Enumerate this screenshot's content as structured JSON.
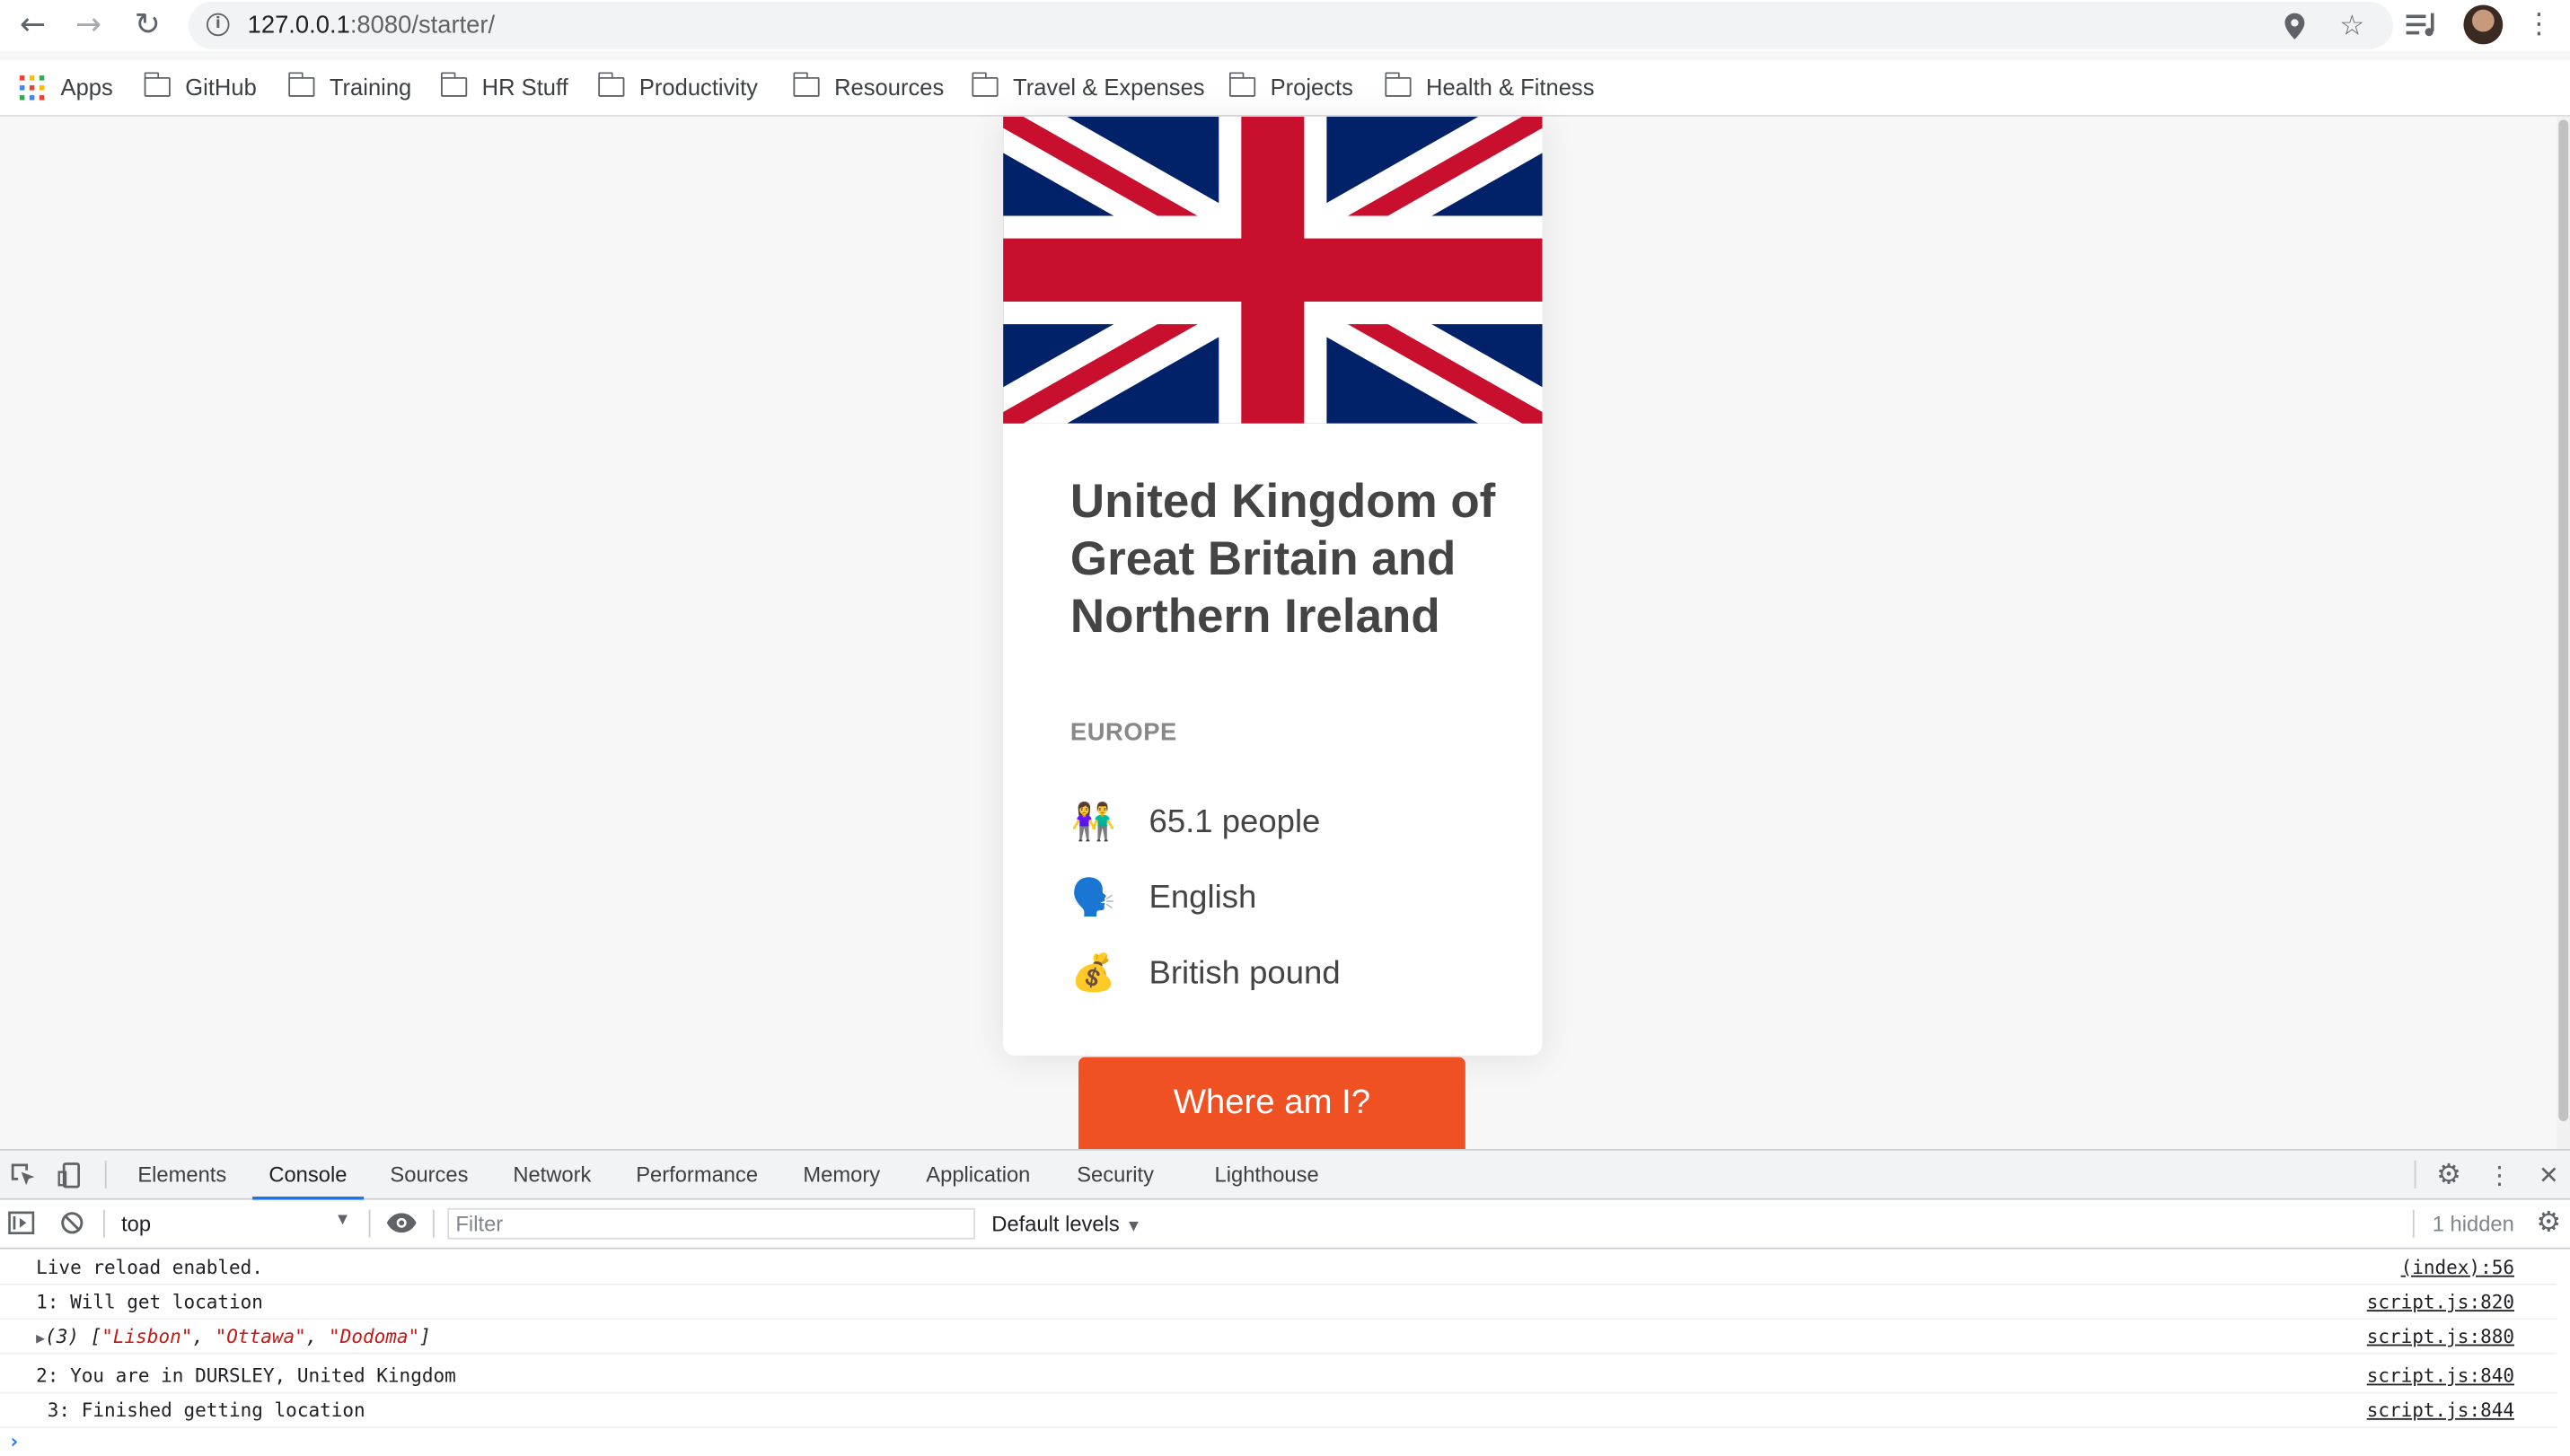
{
  "browser": {
    "url_host": "127.0.0.1",
    "url_path": ":8080/starter/",
    "bookmarks": {
      "apps": "Apps",
      "folders": [
        "GitHub",
        "Training",
        "HR Stuff",
        "Productivity",
        "Resources",
        "Travel & Expenses",
        "Projects",
        "Health & Fitness"
      ]
    },
    "icons": {
      "back": "back-arrow-icon",
      "forward": "forward-arrow-icon",
      "reload": "reload-icon",
      "site_info": "info-icon",
      "location": "location-pin-icon",
      "bookmark": "star-icon",
      "media": "media-control-icon",
      "menu": "kebab-menu-icon"
    }
  },
  "country": {
    "name": "United Kingdom of Great Britain and Northern Ireland",
    "region": "EUROPE",
    "population": "65.1 people",
    "language": "English",
    "currency": "British pound",
    "icons": {
      "population": "👫",
      "language": "🗣️",
      "currency": "💰"
    },
    "flag_colors": {
      "blue": "#012169",
      "red": "#C8102E",
      "white": "#FFFFFF"
    }
  },
  "action_button": "Where am I?",
  "accent_color": "#F05123",
  "devtools": {
    "tabs": [
      "Elements",
      "Console",
      "Sources",
      "Network",
      "Performance",
      "Memory",
      "Application",
      "Security",
      "Lighthouse"
    ],
    "active_tab": "Console",
    "context": "top",
    "filter_placeholder": "Filter",
    "levels": "Default levels",
    "hidden": "1 hidden",
    "console": [
      {
        "message": "Live reload enabled.",
        "source": "(index):56"
      },
      {
        "message": "1: Will get location",
        "source": "script.js:820"
      },
      {
        "message_prefix": "(3) [",
        "items": [
          "\"Lisbon\"",
          "\"Ottawa\"",
          "\"Dodoma\""
        ],
        "message_suffix": "]",
        "source": "script.js:880"
      },
      {
        "message": "2: You are in DURSLEY, United Kingdom",
        "source": "script.js:840"
      },
      {
        "message": " 3: Finished getting location",
        "source": "script.js:844"
      }
    ],
    "prompt": "›"
  }
}
